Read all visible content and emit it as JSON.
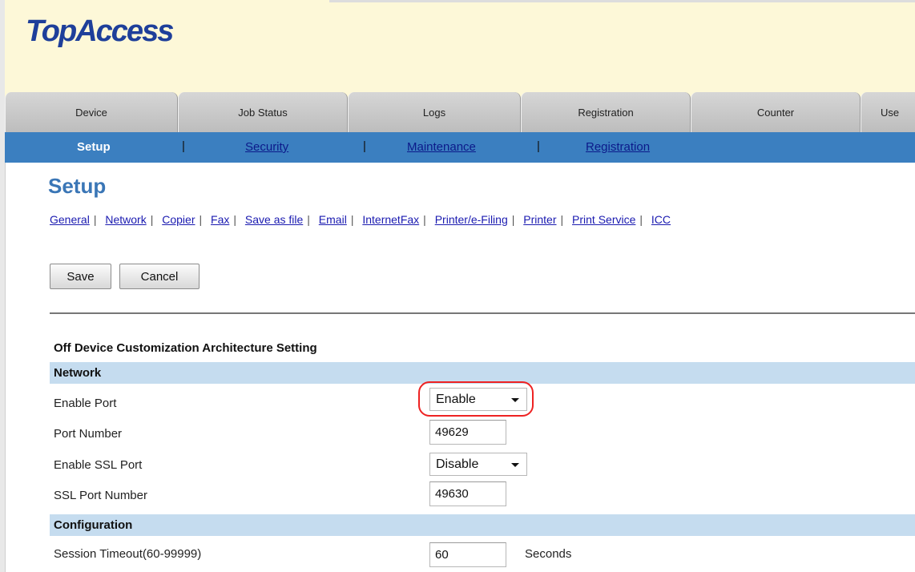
{
  "app": {
    "logo": "TopAccess"
  },
  "tabs": [
    {
      "label": "Device"
    },
    {
      "label": "Job Status"
    },
    {
      "label": "Logs"
    },
    {
      "label": "Registration"
    },
    {
      "label": "Counter"
    },
    {
      "label": "Use"
    }
  ],
  "subnav": {
    "items": [
      {
        "label": "Setup",
        "active": true
      },
      {
        "label": "Security"
      },
      {
        "label": "Maintenance"
      },
      {
        "label": "Registration"
      }
    ],
    "separator": "|"
  },
  "page": {
    "title": "Setup"
  },
  "sublinks": [
    "General",
    "Network",
    "Copier",
    "Fax",
    "Save as file",
    "Email",
    "InternetFax",
    "Printer/e-Filing",
    "Printer",
    "Print Service",
    "ICC"
  ],
  "sublink_separator": "|",
  "buttons": {
    "save": "Save",
    "cancel": "Cancel"
  },
  "form": {
    "title": "Off Device Customization Architecture Setting",
    "network": {
      "heading": "Network",
      "enable_port": {
        "label": "Enable Port",
        "value": "Enable"
      },
      "port_number": {
        "label": "Port Number",
        "value": "49629"
      },
      "enable_ssl_port": {
        "label": "Enable SSL Port",
        "value": "Disable"
      },
      "ssl_port_number": {
        "label": "SSL Port Number",
        "value": "49630"
      }
    },
    "configuration": {
      "heading": "Configuration",
      "session_timeout": {
        "label": "Session Timeout(60-99999)",
        "value": "60",
        "unit": "Seconds"
      }
    }
  },
  "colors": {
    "header_bg": "#fdf8d8",
    "subnav_bg": "#3b7fc0",
    "section_band": "#c5dcef",
    "title_blue": "#3a76b6",
    "highlight": "#ee2222"
  }
}
